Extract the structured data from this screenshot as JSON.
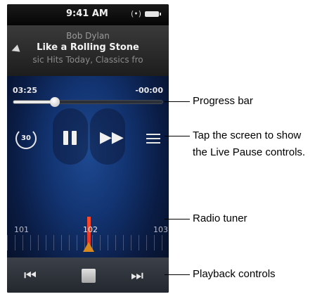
{
  "status": {
    "time": "9:41 AM",
    "radio_icon": "radio-signal-icon",
    "battery_icon": "battery-icon"
  },
  "now_playing": {
    "artist": "Bob Dylan",
    "title": "Like a Rolling Stone",
    "station": "sic Hits Today, Classics fro"
  },
  "progress": {
    "elapsed": "03:25",
    "remaining": "-00:00",
    "position": 0.28
  },
  "controls": {
    "skip_back_label": "30",
    "play_pause_icon": "pause-icon",
    "fast_forward_icon": "fast-forward-icon",
    "menu_icon": "menu-icon"
  },
  "tuner": {
    "left_freq": "101",
    "current_freq": "102",
    "right_freq": "103"
  },
  "playback": {
    "previous_icon": "previous-track-icon",
    "stop_icon": "stop-icon",
    "next_icon": "next-track-icon"
  },
  "callouts": {
    "progress_bar": "Progress bar",
    "live_pause_line1": "Tap the screen to show",
    "live_pause_line2": "the Live Pause controls.",
    "radio_tuner": "Radio tuner",
    "playback_controls": "Playback controls"
  }
}
